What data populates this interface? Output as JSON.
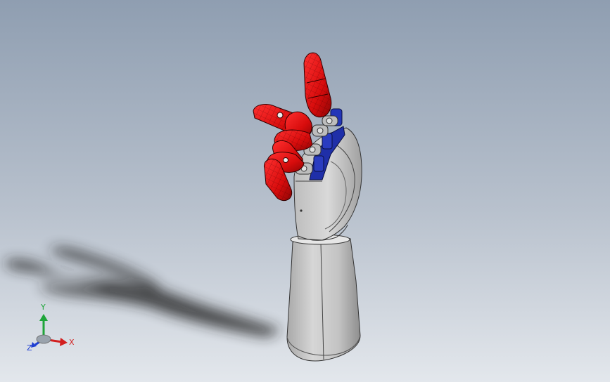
{
  "colors": {
    "background_top": "#8f9eb1",
    "background_bottom": "#e3e7ec",
    "finger_red": "#e01010",
    "joint_blue": "#1f2fa8",
    "shell_gray": "#c9c9c9",
    "shadow": "#1e1e1e"
  },
  "triad": {
    "x_label": "X",
    "y_label": "Y",
    "z_label": "Z",
    "x_color": "#d21f1f",
    "y_color": "#1fa53a",
    "z_color": "#1f3fd2"
  }
}
